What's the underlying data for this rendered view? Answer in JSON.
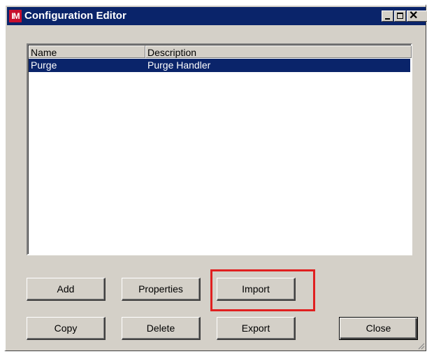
{
  "window": {
    "title": "Configuration Editor",
    "app_icon_text": "IM",
    "controls": {
      "minimize_icon": "minimize-icon",
      "maximize_icon": "maximize-icon",
      "close_icon": "close-icon",
      "close_glyph": "✕"
    }
  },
  "list": {
    "columns": [
      "Name",
      "Description"
    ],
    "rows": [
      {
        "name": "Purge",
        "description": "Purge Handler",
        "selected": true
      }
    ]
  },
  "buttons": {
    "add": "Add",
    "properties": "Properties",
    "import": "Import",
    "copy": "Copy",
    "delete": "Delete",
    "export": "Export",
    "close": "Close"
  },
  "highlight": {
    "target": "import-button",
    "color": "#e02020"
  },
  "colors": {
    "titlebar": "#0a246a",
    "selection": "#0a246a",
    "dialog_face": "#d4d0c8",
    "app_icon": "#c8102e"
  }
}
